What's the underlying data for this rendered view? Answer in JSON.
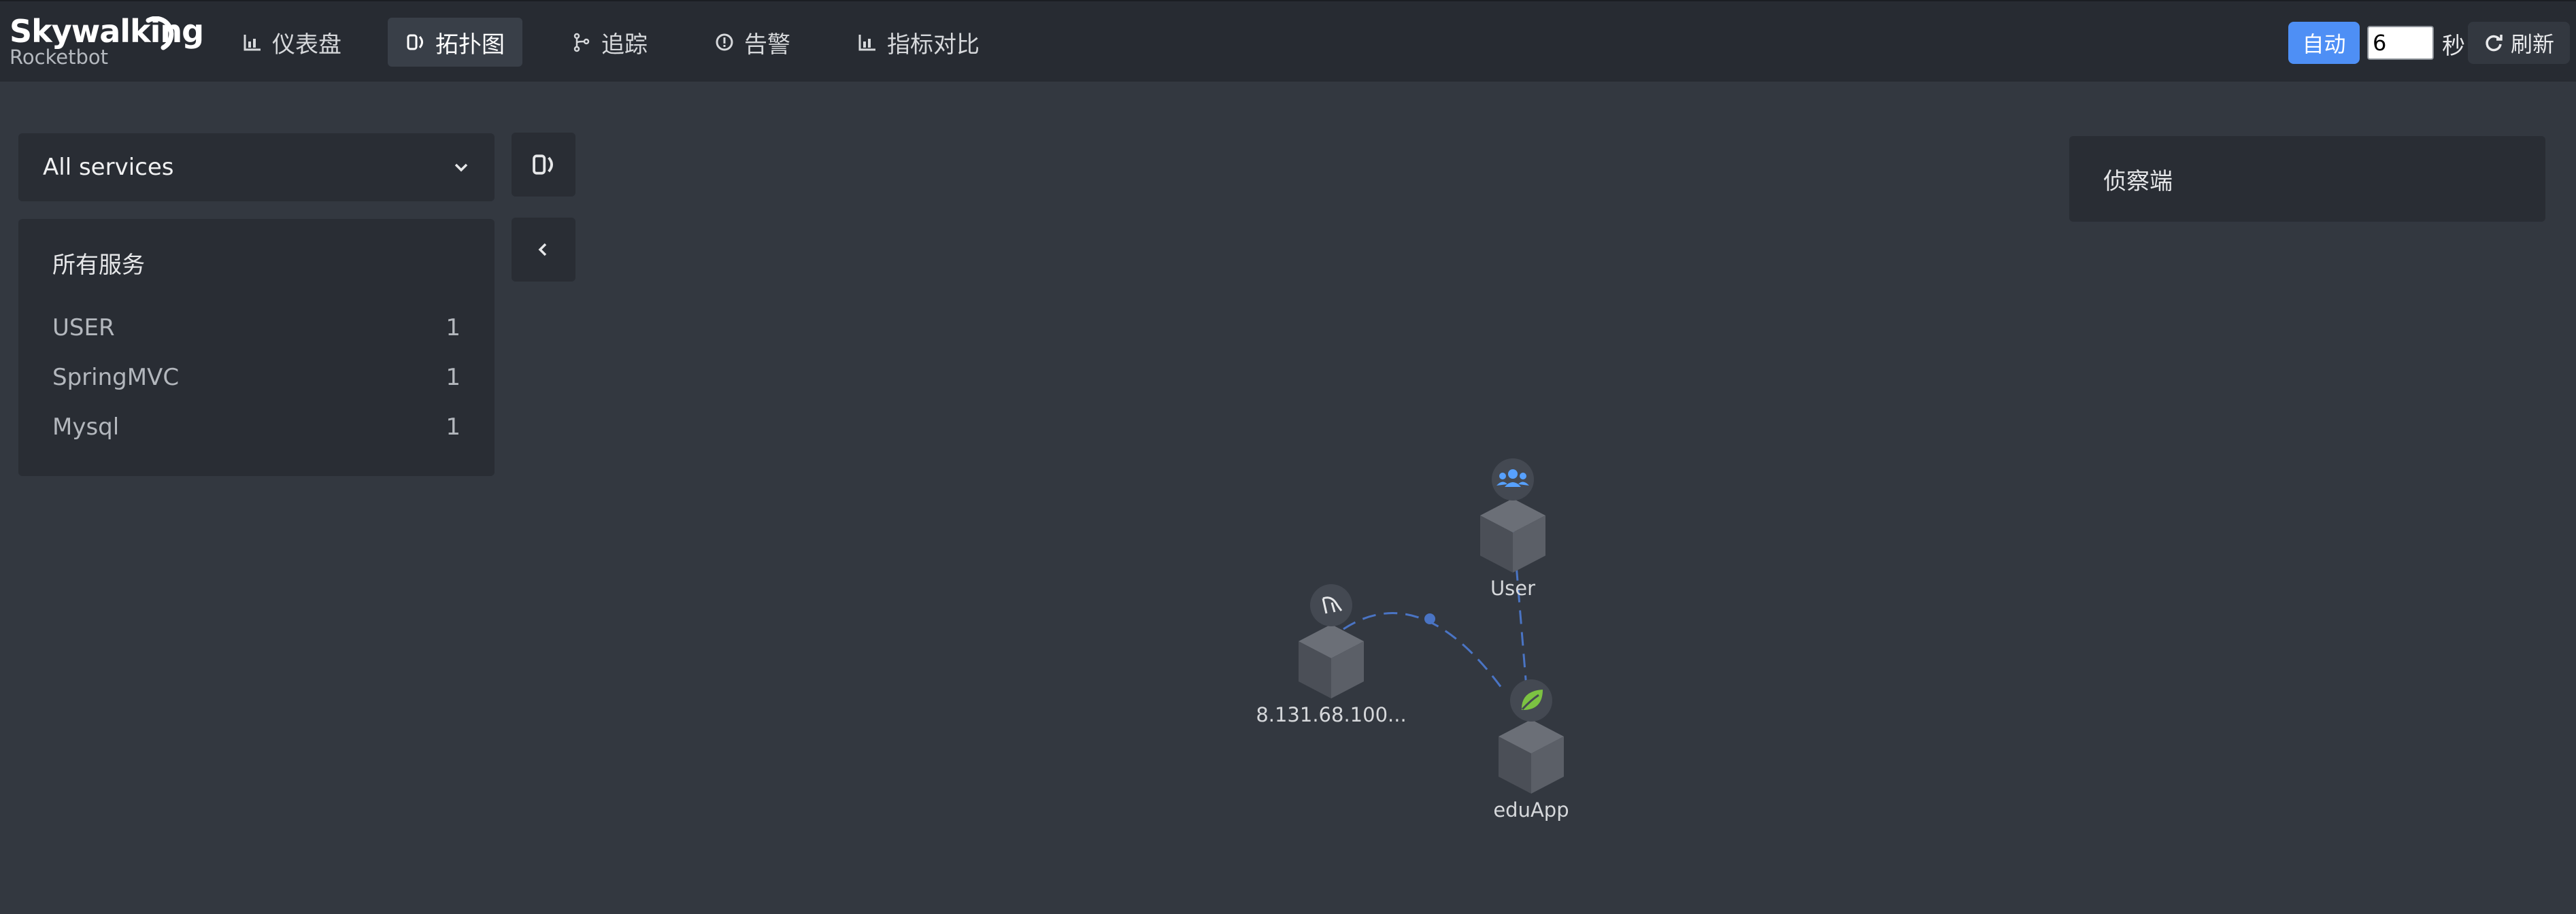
{
  "header": {
    "logo_title": "Skywalking",
    "logo_subtitle": "Rocketbot",
    "nav": [
      {
        "label": "仪表盘",
        "icon": "chart-icon"
      },
      {
        "label": "拓扑图",
        "icon": "topology-icon"
      },
      {
        "label": "追踪",
        "icon": "trace-icon"
      },
      {
        "label": "告警",
        "icon": "alert-icon"
      },
      {
        "label": "指标对比",
        "icon": "chart-icon"
      }
    ],
    "active_nav": "拓扑图",
    "auto_label": "自动",
    "interval_value": "6",
    "seconds_label": "秒",
    "refresh_label": "刷新"
  },
  "sidebar": {
    "select_value": "All services",
    "panel_title": "所有服务",
    "services": [
      {
        "name": "USER",
        "count": "1"
      },
      {
        "name": "SpringMVC",
        "count": "1"
      },
      {
        "name": "Mysql",
        "count": "1"
      }
    ]
  },
  "detector": {
    "title": "侦察端"
  },
  "topology": {
    "nodes": [
      {
        "label": "User",
        "type": "user"
      },
      {
        "label": "8.131.68.100...",
        "type": "mysql"
      },
      {
        "label": "eduApp",
        "type": "spring"
      }
    ],
    "colors": {
      "edge": "#4a74c4",
      "user_badge": "#57a1ff",
      "spring_badge": "#7cc242"
    }
  }
}
